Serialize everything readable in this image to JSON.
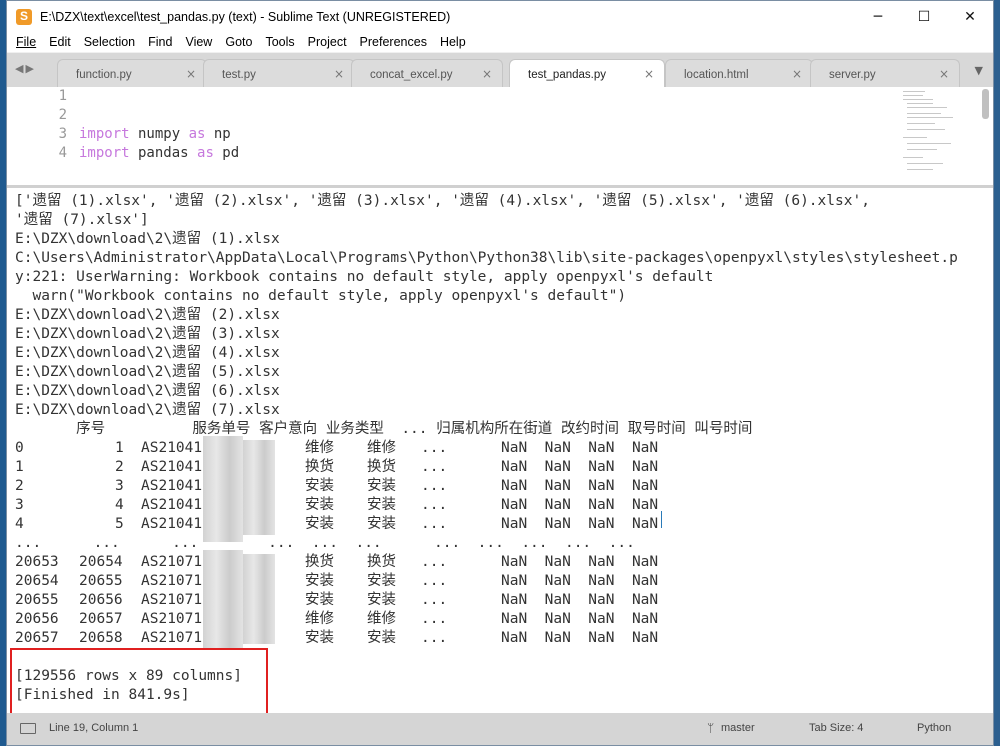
{
  "window": {
    "title": "E:\\DZX\\text\\excel\\test_pandas.py (text) - Sublime Text (UNREGISTERED)",
    "controls": {
      "minimize": "─",
      "maximize": "☐",
      "close": "✕"
    }
  },
  "menu": [
    "File",
    "Edit",
    "Selection",
    "Find",
    "View",
    "Goto",
    "Tools",
    "Project",
    "Preferences",
    "Help"
  ],
  "tabs": [
    {
      "label": "function.py",
      "active": false
    },
    {
      "label": "test.py",
      "active": false
    },
    {
      "label": "concat_excel.py",
      "active": false
    },
    {
      "label": "test_pandas.py",
      "active": true
    },
    {
      "label": "location.html",
      "active": false
    },
    {
      "label": "server.py",
      "active": false
    }
  ],
  "tab_close": "×",
  "tab_arrows": "◀▶",
  "tab_dropdown": "▼",
  "editor": {
    "line_numbers": [
      "1",
      "2",
      "3",
      "4"
    ],
    "code": [
      {
        "kw": "",
        "rest": ""
      },
      {
        "kw": "",
        "rest": ""
      },
      {
        "kw": "import",
        "rest": " numpy ",
        "kw2": "as",
        "rest2": " np"
      },
      {
        "kw": "import",
        "rest": " pandas ",
        "kw2": "as",
        "rest2": " pd"
      }
    ]
  },
  "output": {
    "lines": [
      "['遗留 (1).xlsx', '遗留 (2).xlsx', '遗留 (3).xlsx', '遗留 (4).xlsx', '遗留 (5).xlsx', '遗留 (6).xlsx',",
      "'遗留 (7).xlsx']",
      "E:\\DZX\\download\\2\\遗留 (1).xlsx",
      "C:\\Users\\Administrator\\AppData\\Local\\Programs\\Python\\Python38\\lib\\site-packages\\openpyxl\\styles\\stylesheet.p",
      "y:221: UserWarning: Workbook contains no default style, apply openpyxl's default",
      "  warn(\"Workbook contains no default style, apply openpyxl's default\")",
      "E:\\DZX\\download\\2\\遗留 (2).xlsx",
      "E:\\DZX\\download\\2\\遗留 (3).xlsx",
      "E:\\DZX\\download\\2\\遗留 (4).xlsx",
      "E:\\DZX\\download\\2\\遗留 (5).xlsx",
      "E:\\DZX\\download\\2\\遗留 (6).xlsx",
      "E:\\DZX\\download\\2\\遗留 (7).xlsx"
    ],
    "df_header": "       序号          服务单号 客户意向 业务类型  ... 归属机构所在街道 改约时间 取号时间 叫号时间",
    "df_rows": [
      {
        "idx": "0",
        "seq": "1",
        "order": "AS21041",
        "intent": "维修",
        "type": "维修",
        "dots": "...",
        "nans": "NaN  NaN  NaN  NaN"
      },
      {
        "idx": "1",
        "seq": "2",
        "order": "AS21041",
        "intent": "换货",
        "type": "换货",
        "dots": "...",
        "nans": "NaN  NaN  NaN  NaN"
      },
      {
        "idx": "2",
        "seq": "3",
        "order": "AS21041",
        "intent": "安装",
        "type": "安装",
        "dots": "...",
        "nans": "NaN  NaN  NaN  NaN"
      },
      {
        "idx": "3",
        "seq": "4",
        "order": "AS21041",
        "intent": "安装",
        "type": "安装",
        "dots": "...",
        "nans": "NaN  NaN  NaN  NaN"
      },
      {
        "idx": "4",
        "seq": "5",
        "order": "AS21041",
        "intent": "安装",
        "type": "安装",
        "dots": "...",
        "nans": "NaN  NaN  NaN  NaN"
      }
    ],
    "df_ellipsis": "...      ...      ...        ...  ...  ...      ...  ...  ...  ...  ...",
    "df_rows2": [
      {
        "idx": "20653",
        "seq": "20654",
        "order": "AS21071",
        "intent": "换货",
        "type": "换货",
        "dots": "...",
        "nans": "NaN  NaN  NaN  NaN"
      },
      {
        "idx": "20654",
        "seq": "20655",
        "order": "AS21071",
        "intent": "安装",
        "type": "安装",
        "dots": "...",
        "nans": "NaN  NaN  NaN  NaN"
      },
      {
        "idx": "20655",
        "seq": "20656",
        "order": "AS21071",
        "intent": "安装",
        "type": "安装",
        "dots": "...",
        "nans": "NaN  NaN  NaN  NaN"
      },
      {
        "idx": "20656",
        "seq": "20657",
        "order": "AS21071",
        "intent": "维修",
        "type": "维修",
        "dots": "...",
        "nans": "NaN  NaN  NaN  NaN"
      },
      {
        "idx": "20657",
        "seq": "20658",
        "order": "AS21071",
        "intent": "安装",
        "type": "安装",
        "dots": "...",
        "nans": "NaN  NaN  NaN  NaN"
      }
    ],
    "summary": "[129556 rows x 89 columns]",
    "finished": "[Finished in 841.9s]"
  },
  "status": {
    "position": "Line 19, Column 1",
    "branch": "master",
    "tab_size": "Tab Size: 4",
    "syntax": "Python"
  }
}
